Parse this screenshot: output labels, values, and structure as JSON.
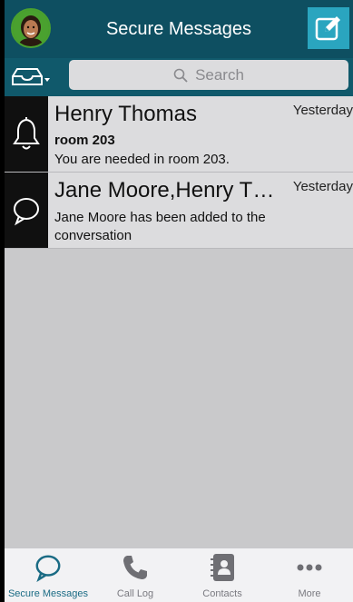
{
  "header": {
    "title": "Secure Messages"
  },
  "search": {
    "placeholder": "Search"
  },
  "conversations": [
    {
      "title": "Henry Thomas",
      "time": "Yesterday",
      "subject": "room 203",
      "preview": "You are needed in room 203.",
      "icon": "bell-icon"
    },
    {
      "title": "Jane Moore,Henry Th…",
      "time": "Yesterday",
      "preview": "Jane Moore has been added to the conversation",
      "icon": "chat-bubble-icon"
    }
  ],
  "tabs": [
    {
      "label": "Secure Messages",
      "icon": "chat-bubble-icon",
      "active": true
    },
    {
      "label": "Call Log",
      "icon": "phone-icon",
      "active": false
    },
    {
      "label": "Contacts",
      "icon": "contacts-book-icon",
      "active": false
    },
    {
      "label": "More",
      "icon": "more-dots-icon",
      "active": false
    }
  ],
  "colors": {
    "header_bg": "#0e4f61",
    "search_row_bg": "#10596b",
    "accent": "#2aa5bf",
    "active_tab": "#1a6b84"
  }
}
